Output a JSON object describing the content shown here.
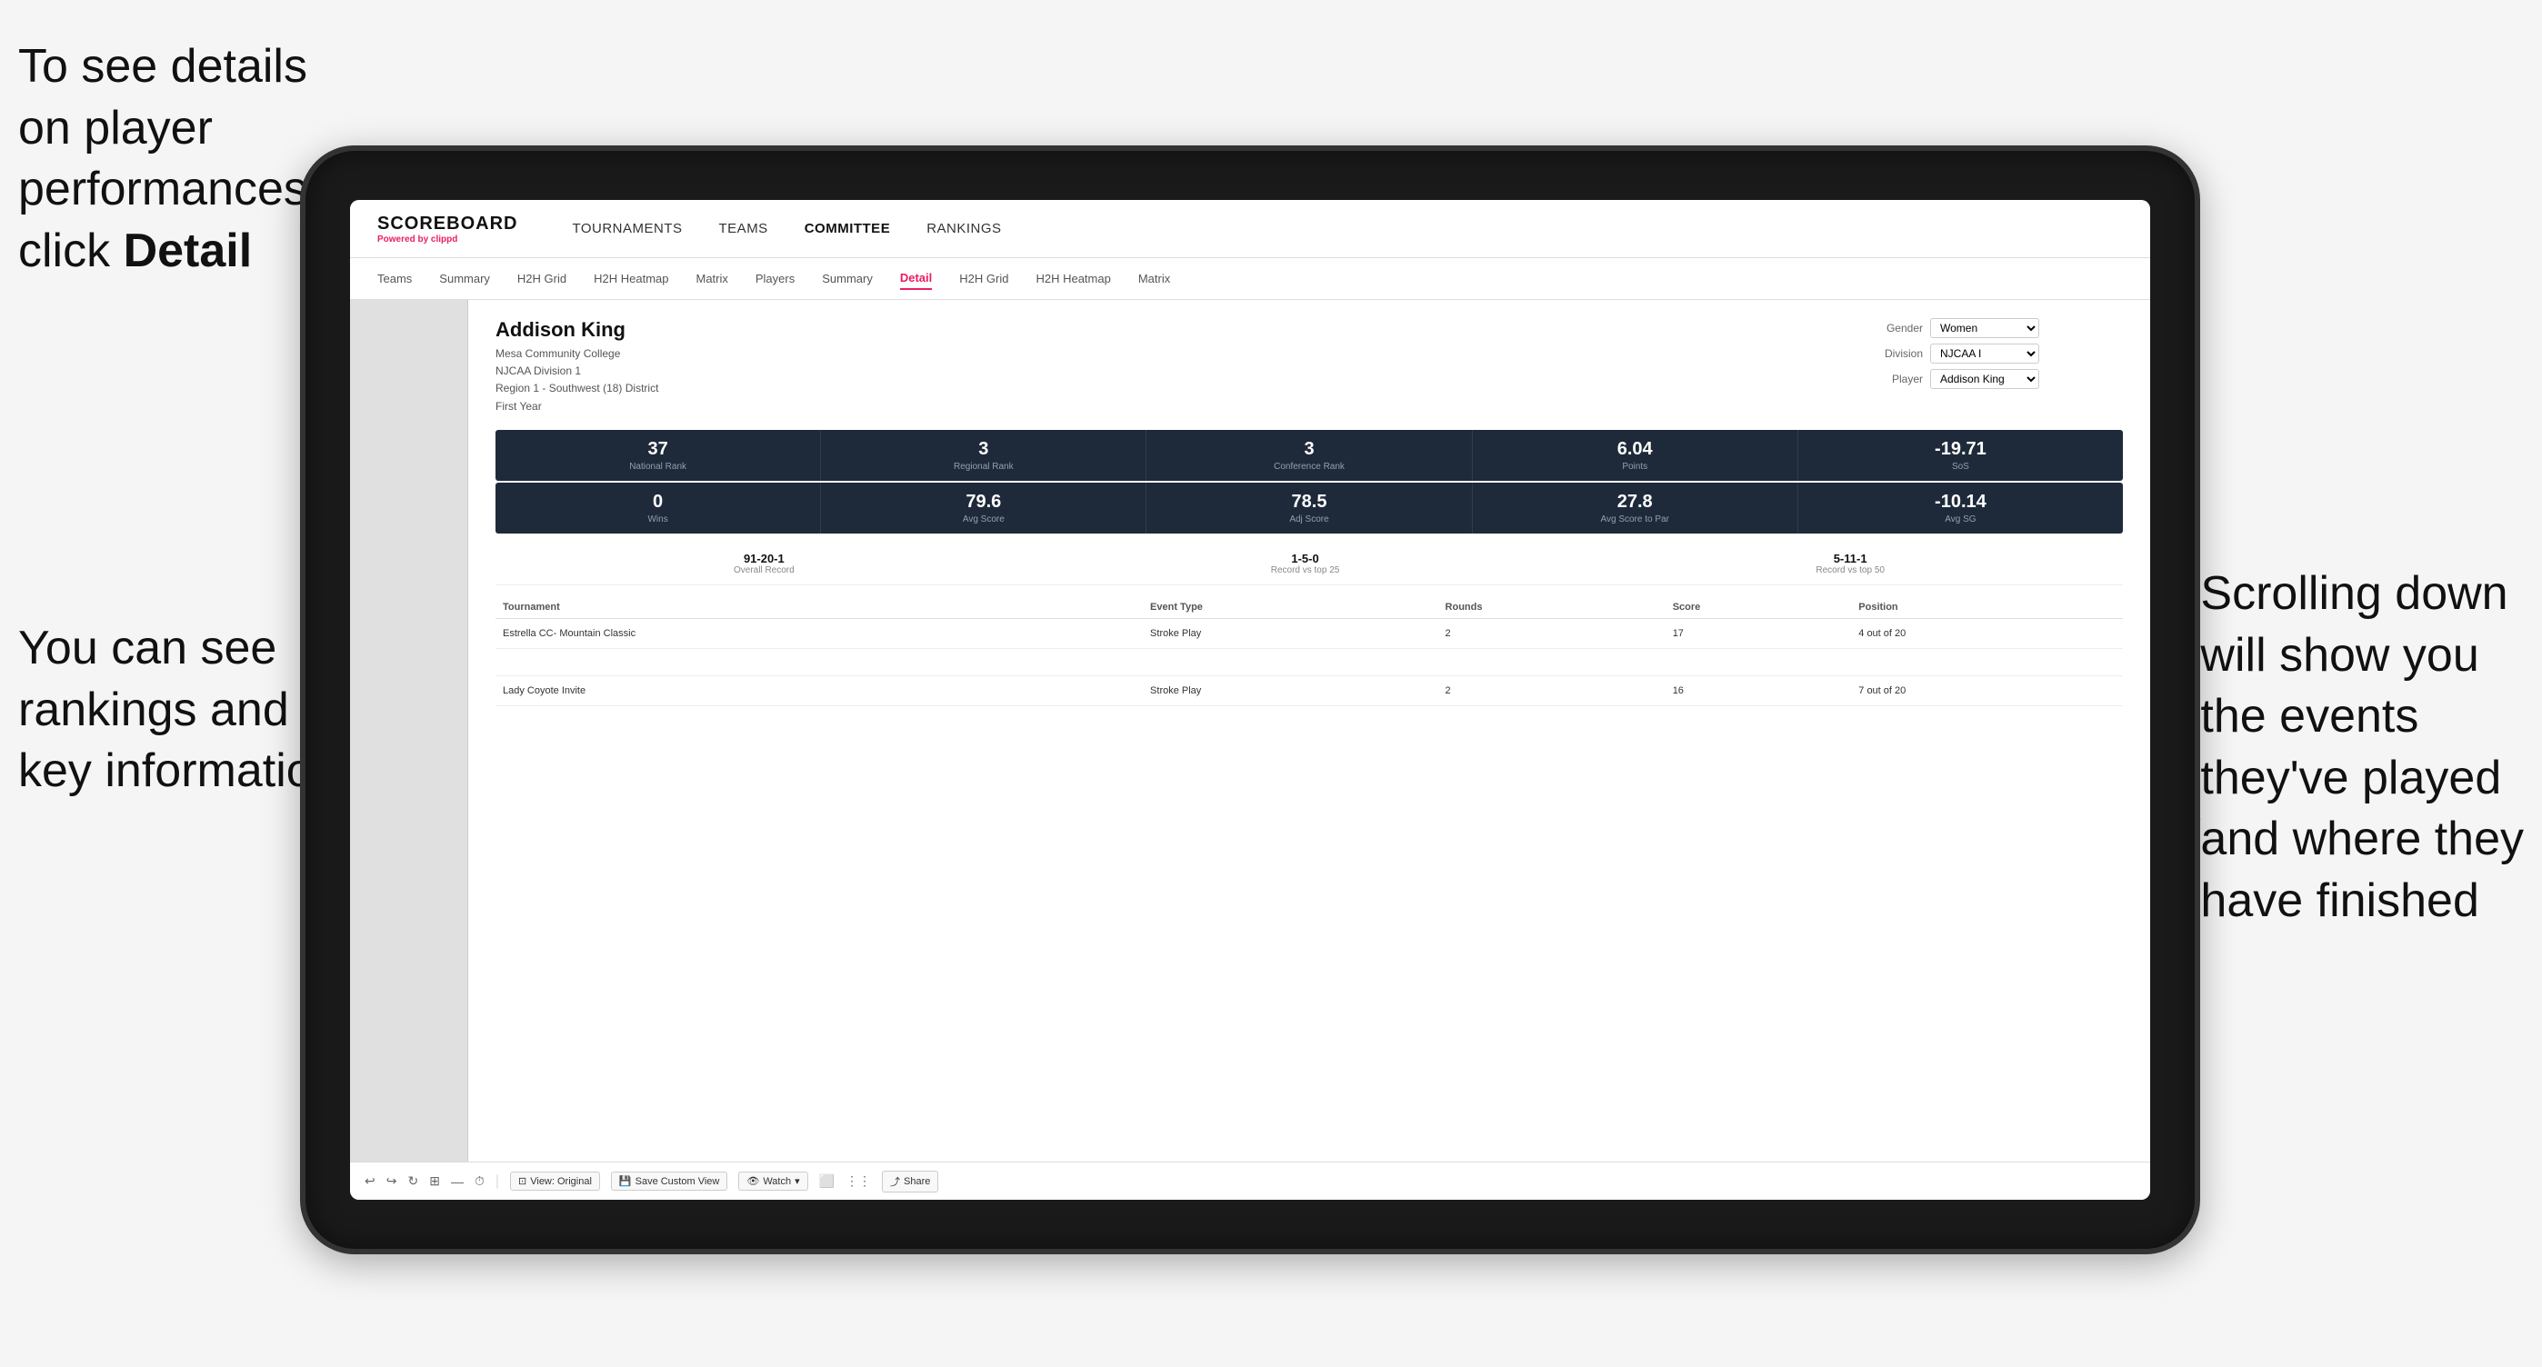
{
  "annotations": {
    "top_left": "To see details on player performances click ",
    "top_left_bold": "Detail",
    "bottom_left_line1": "You can see",
    "bottom_left_line2": "rankings and",
    "bottom_left_line3": "key information",
    "right_line1": "Scrolling down",
    "right_line2": "will show you",
    "right_line3": "the events",
    "right_line4": "they've played",
    "right_line5": "and where they",
    "right_line6": "have finished"
  },
  "header": {
    "logo_title": "SCOREBOARD",
    "logo_sub_prefix": "Powered by ",
    "logo_sub_brand": "clippd",
    "nav_items": [
      {
        "label": "TOURNAMENTS",
        "active": false
      },
      {
        "label": "TEAMS",
        "active": false
      },
      {
        "label": "COMMITTEE",
        "active": true
      },
      {
        "label": "RANKINGS",
        "active": false
      }
    ]
  },
  "sub_nav": {
    "items": [
      {
        "label": "Teams",
        "active": false
      },
      {
        "label": "Summary",
        "active": false
      },
      {
        "label": "H2H Grid",
        "active": false
      },
      {
        "label": "H2H Heatmap",
        "active": false
      },
      {
        "label": "Matrix",
        "active": false
      },
      {
        "label": "Players",
        "active": false
      },
      {
        "label": "Summary",
        "active": false
      },
      {
        "label": "Detail",
        "active": true
      },
      {
        "label": "H2H Grid",
        "active": false
      },
      {
        "label": "H2H Heatmap",
        "active": false
      },
      {
        "label": "Matrix",
        "active": false
      }
    ]
  },
  "player": {
    "name": "Addison King",
    "college": "Mesa Community College",
    "division": "NJCAA Division 1",
    "region": "Region 1 - Southwest (18) District",
    "year": "First Year",
    "gender_label": "Gender",
    "gender_value": "Women",
    "division_label": "Division",
    "division_value": "NJCAA I",
    "player_label": "Player",
    "player_value": "Addison King"
  },
  "stats_row1": [
    {
      "value": "37",
      "label": "National Rank"
    },
    {
      "value": "3",
      "label": "Regional Rank"
    },
    {
      "value": "3",
      "label": "Conference Rank"
    },
    {
      "value": "6.04",
      "label": "Points"
    },
    {
      "value": "-19.71",
      "label": "SoS"
    }
  ],
  "stats_row2": [
    {
      "value": "0",
      "label": "Wins"
    },
    {
      "value": "79.6",
      "label": "Avg Score"
    },
    {
      "value": "78.5",
      "label": "Adj Score"
    },
    {
      "value": "27.8",
      "label": "Avg Score to Par"
    },
    {
      "value": "-10.14",
      "label": "Avg SG"
    }
  ],
  "records": [
    {
      "value": "91-20-1",
      "label": "Overall Record"
    },
    {
      "value": "1-5-0",
      "label": "Record vs top 25"
    },
    {
      "value": "5-11-1",
      "label": "Record vs top 50"
    }
  ],
  "table": {
    "headers": [
      "Tournament",
      "Event Type",
      "Rounds",
      "Score",
      "Position"
    ],
    "rows": [
      {
        "tournament": "Estrella CC- Mountain Classic",
        "event_type": "Stroke Play",
        "rounds": "2",
        "score": "17",
        "position": "4 out of 20"
      },
      {
        "tournament": "",
        "event_type": "",
        "rounds": "",
        "score": "",
        "position": ""
      },
      {
        "tournament": "Lady Coyote Invite",
        "event_type": "Stroke Play",
        "rounds": "2",
        "score": "16",
        "position": "7 out of 20"
      }
    ]
  },
  "toolbar": {
    "view_original": "View: Original",
    "save_custom": "Save Custom View",
    "watch": "Watch",
    "share": "Share"
  }
}
